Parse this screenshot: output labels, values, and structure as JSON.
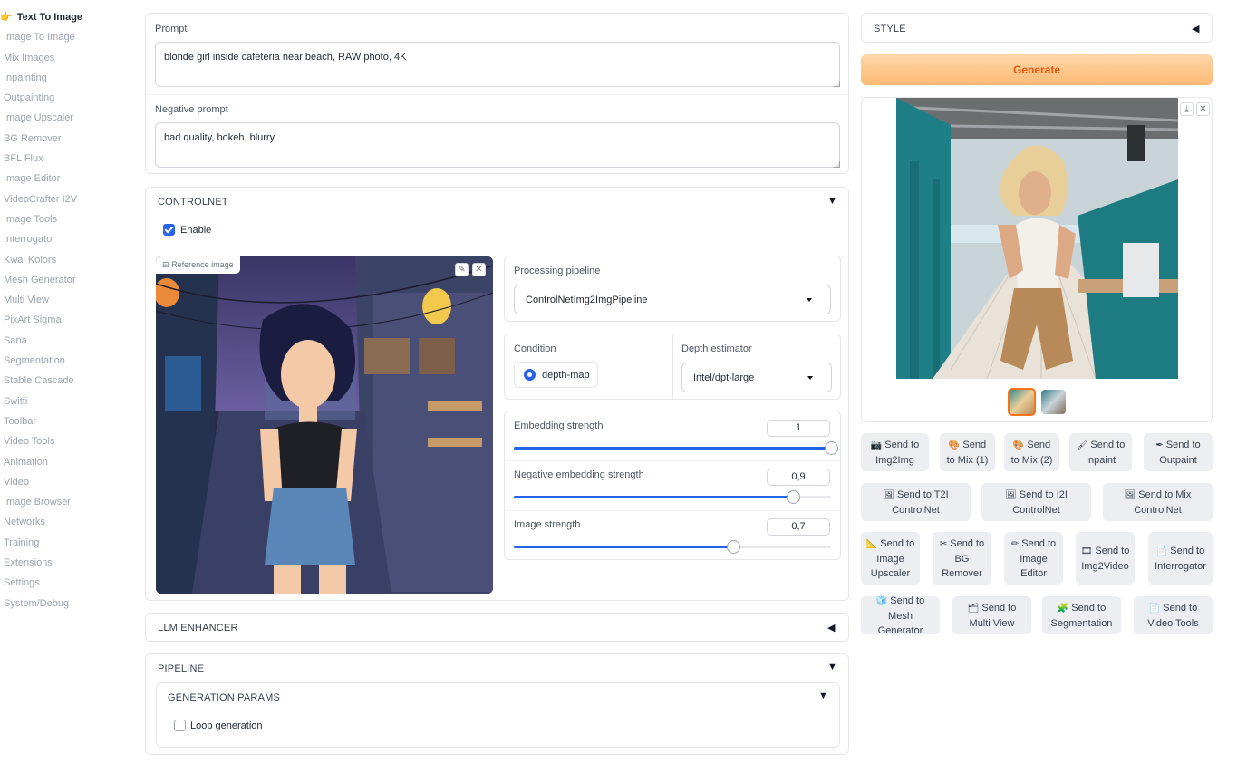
{
  "sidebar": {
    "items": [
      {
        "label": "Text To Image",
        "active": true
      },
      {
        "label": "Image To Image"
      },
      {
        "label": "Mix Images"
      },
      {
        "label": "Inpainting"
      },
      {
        "label": "Outpainting"
      },
      {
        "label": "Image Upscaler"
      },
      {
        "label": "BG Remover"
      },
      {
        "label": "BFL Flux"
      },
      {
        "label": "Image Editor"
      },
      {
        "label": "VideoCrafter I2V"
      },
      {
        "label": "Image Tools"
      },
      {
        "label": "Interrogator"
      },
      {
        "label": "Kwai Kolors"
      },
      {
        "label": "Mesh Generator"
      },
      {
        "label": "Multi View"
      },
      {
        "label": "PixArt Sigma"
      },
      {
        "label": "Sana"
      },
      {
        "label": "Segmentation"
      },
      {
        "label": "Stable Cascade"
      },
      {
        "label": "Switti"
      },
      {
        "label": "Toolbar"
      },
      {
        "label": "Video Tools"
      },
      {
        "label": "Animation"
      },
      {
        "label": "Video"
      },
      {
        "label": "Image Browser"
      },
      {
        "label": "Networks"
      },
      {
        "label": "Training"
      },
      {
        "label": "Extensions"
      },
      {
        "label": "Settings"
      },
      {
        "label": "System/Debug"
      }
    ]
  },
  "prompt": {
    "label": "Prompt",
    "value": "blonde girl inside cafeteria near beach, RAW photo, 4K"
  },
  "negative_prompt": {
    "label": "Negative prompt",
    "value": "bad quality, bokeh, blurry"
  },
  "controlnet": {
    "title": "CONTROLNET",
    "enable_label": "Enable",
    "enabled": true,
    "reference_label": "Reference image",
    "pipeline_label": "Processing pipeline",
    "pipeline_value": "ControlNetImg2ImgPipeline",
    "condition_label": "Condition",
    "condition_value": "depth-map",
    "depth_label": "Depth estimator",
    "depth_value": "Intel/dpt-large",
    "sliders": [
      {
        "label": "Embedding strength",
        "value": "1",
        "fraction": 1.0
      },
      {
        "label": "Negative embedding strength",
        "value": "0,9",
        "fraction": 0.9
      },
      {
        "label": "Image strength",
        "value": "0,7",
        "fraction": 0.7
      }
    ]
  },
  "llm_enhancer": {
    "title": "LLM ENHANCER"
  },
  "pipeline": {
    "title": "PIPELINE",
    "gen_params_title": "GENERATION PARAMS",
    "loop_label": "Loop generation",
    "loop_checked": false
  },
  "style": {
    "title": "STYLE"
  },
  "generate_label": "Generate",
  "colors": {
    "accent": "#2563eb",
    "generate_top": "#fed7aa",
    "generate_text": "#ea580c",
    "thumb_selected": "#f97316"
  },
  "send_rows": [
    [
      {
        "icon": "camera-icon",
        "glyph": "📷",
        "label": "Send to Img2Img"
      },
      {
        "icon": "palette-icon",
        "glyph": "🎨",
        "label": "Send to Mix (1)"
      },
      {
        "icon": "palette-icon",
        "glyph": "🎨",
        "label": "Send to Mix (2)"
      },
      {
        "icon": "brush-icon",
        "glyph": "🖌",
        "label": "Send to Inpaint"
      },
      {
        "icon": "pen-icon",
        "glyph": "✒",
        "label": "Send to Outpaint"
      }
    ],
    [
      {
        "icon": "picture-icon",
        "glyph": "🖼",
        "label": "Send to T2I ControlNet"
      },
      {
        "icon": "picture-icon",
        "glyph": "🖼",
        "label": "Send to I2I ControlNet"
      },
      {
        "icon": "picture-icon",
        "glyph": "🖼",
        "label": "Send to Mix ControlNet"
      }
    ],
    [
      {
        "icon": "ruler-icon",
        "glyph": "📐",
        "label": "Send to Image Upscaler"
      },
      {
        "icon": "scissors-icon",
        "glyph": "✂",
        "label": "Send to BG Remover"
      },
      {
        "icon": "pencil-icon",
        "glyph": "✏",
        "label": "Send to Image Editor"
      },
      {
        "icon": "film-icon",
        "glyph": "🎞",
        "label": "Send to Img2Video"
      },
      {
        "icon": "document-icon",
        "glyph": "📄",
        "label": "Send to Interrogator"
      }
    ],
    [
      {
        "icon": "cube-icon",
        "glyph": "🧊",
        "label": "Send to Mesh Generator"
      },
      {
        "icon": "views-icon",
        "glyph": "🗂",
        "label": "Send to Multi View"
      },
      {
        "icon": "segment-icon",
        "glyph": "🧩",
        "label": "Send to Segmentation"
      },
      {
        "icon": "video-icon",
        "glyph": "📄",
        "label": "Send to Video Tools"
      }
    ]
  ]
}
